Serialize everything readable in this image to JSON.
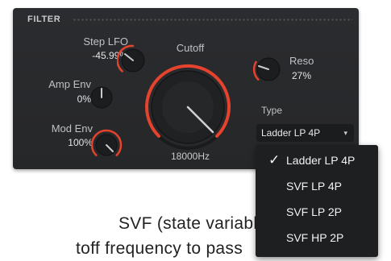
{
  "panel": {
    "title": "FILTER",
    "step_lfo": {
      "label": "Step LFO",
      "value": "-45.99%"
    },
    "amp_env": {
      "label": "Amp Env",
      "value": "0%"
    },
    "mod_env": {
      "label": "Mod Env",
      "value": "100%"
    },
    "cutoff": {
      "label": "Cutoff",
      "value": "18000Hz"
    },
    "reso": {
      "label": "Reso",
      "value": "27%"
    },
    "type": {
      "label": "Type",
      "selected": "Ladder LP 4P"
    }
  },
  "menu": {
    "items": [
      {
        "label": "Ladder LP 4P",
        "checked": true
      },
      {
        "label": "SVF LP 4P",
        "checked": false
      },
      {
        "label": "SVF LP 2P",
        "checked": false
      },
      {
        "label": "SVF HP 2P",
        "checked": false
      }
    ],
    "check_glyph": "✓"
  },
  "background": {
    "line1": "SVF (state variable",
    "line2": "toff frequency to pass"
  },
  "colors": {
    "accent": "#e5432e",
    "panel": "#2a2b2e",
    "knob": "#1c1d1f"
  },
  "icons": {
    "dropdown_arrow": "▾"
  }
}
